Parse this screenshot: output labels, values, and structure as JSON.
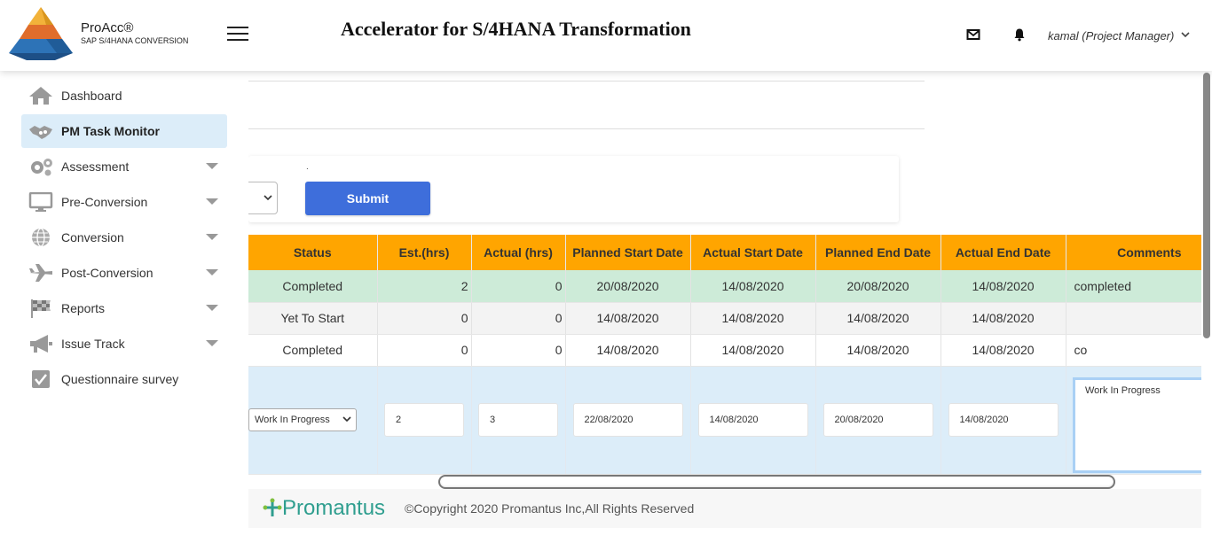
{
  "header": {
    "logo_title": "ProAcc®",
    "logo_subtitle": "SAP S/4HANA CONVERSION",
    "app_title": "Accelerator for S/4HANA Transformation",
    "user": "kamal (Project Manager)"
  },
  "sidebar": {
    "items": [
      {
        "label": "Dashboard",
        "icon": "home-icon",
        "has_caret": false,
        "active": false
      },
      {
        "label": "PM Task Monitor",
        "icon": "handshake-icon",
        "has_caret": false,
        "active": true
      },
      {
        "label": "Assessment",
        "icon": "gears-icon",
        "has_caret": true,
        "active": false
      },
      {
        "label": "Pre-Conversion",
        "icon": "monitor-icon",
        "has_caret": true,
        "active": false
      },
      {
        "label": "Conversion",
        "icon": "globe-icon",
        "has_caret": true,
        "active": false
      },
      {
        "label": "Post-Conversion",
        "icon": "plane-icon",
        "has_caret": true,
        "active": false
      },
      {
        "label": "Reports",
        "icon": "checkered-flag-icon",
        "has_caret": true,
        "active": false
      },
      {
        "label": "Issue Track",
        "icon": "megaphone-icon",
        "has_caret": true,
        "active": false
      },
      {
        "label": "Questionnaire survey",
        "icon": "checkbox-icon",
        "has_caret": false,
        "active": false
      }
    ]
  },
  "filter": {
    "dot_label": ".",
    "submit_label": "Submit"
  },
  "table": {
    "columns": [
      "Status",
      "Est.(hrs)",
      "Actual (hrs)",
      "Planned Start Date",
      "Actual Start Date",
      "Planned End Date",
      "Actual End Date",
      "Comments"
    ],
    "rows": [
      {
        "status": "Completed",
        "est": "2",
        "actual": "0",
        "planned_start": "20/08/2020",
        "actual_start": "14/08/2020",
        "planned_end": "20/08/2020",
        "actual_end": "14/08/2020",
        "comments": "completed"
      },
      {
        "status": "Yet To Start",
        "est": "0",
        "actual": "0",
        "planned_start": "14/08/2020",
        "actual_start": "14/08/2020",
        "planned_end": "14/08/2020",
        "actual_end": "14/08/2020",
        "comments": ""
      },
      {
        "status": "Completed",
        "est": "0",
        "actual": "0",
        "planned_start": "14/08/2020",
        "actual_start": "14/08/2020",
        "planned_end": "14/08/2020",
        "actual_end": "14/08/2020",
        "comments": "co"
      }
    ],
    "edit_row": {
      "status": "Work In Progress",
      "est": "2",
      "actual": "3",
      "planned_start": "22/08/2020",
      "actual_start": "14/08/2020",
      "planned_end": "20/08/2020",
      "actual_end": "14/08/2020",
      "comments": "Work In Progress"
    }
  },
  "footer": {
    "brand": "Promantus",
    "copyright": "©Copyright 2020 Promantus Inc,All Rights Reserved"
  },
  "colors": {
    "header_orange": "#ffa500",
    "row_green": "#cdebd8",
    "active_blue": "#dcedf9",
    "submit_blue": "#3e6edb",
    "brand_teal": "#2f9e8f"
  }
}
